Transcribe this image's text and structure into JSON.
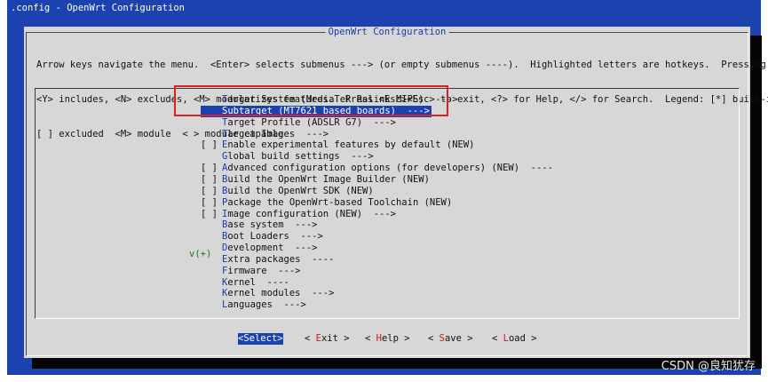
{
  "window": {
    "title": ".config - OpenWrt Configuration"
  },
  "dialog": {
    "title": "OpenWrt Configuration",
    "help_lines": [
      "Arrow keys navigate the menu.  <Enter> selects submenus ---> (or empty submenus ----).  Highlighted letters are hotkeys.  Pressing",
      "<Y> includes, <N> excludes, <M> modularizes features.  Press <Esc><Esc> to exit, <?> for Help, </> for Search.  Legend: [*] built-in",
      "[ ] excluded  <M> module  < > module capable"
    ]
  },
  "menu": {
    "items": [
      {
        "prefix": "",
        "hotkey": "T",
        "rest": "arget System (MediaTek Ralink MIPS)  --->",
        "selected": false
      },
      {
        "prefix": "",
        "hotkey": "S",
        "rest": "ubtarget (MT7621 based boards)  --->",
        "selected": true
      },
      {
        "prefix": "",
        "hotkey": "T",
        "rest": "arget Profile (ADSLR G7)  --->",
        "selected": false
      },
      {
        "prefix": "",
        "hotkey": "T",
        "rest": "arget Images  --->",
        "selected": false
      },
      {
        "prefix": "[ ]",
        "hotkey": "E",
        "rest": "nable experimental features by default (NEW)",
        "selected": false
      },
      {
        "prefix": "",
        "hotkey": "G",
        "rest": "lobal build settings  --->",
        "selected": false
      },
      {
        "prefix": "[ ]",
        "hotkey": "A",
        "rest": "dvanced configuration options (for developers) (NEW)  ----",
        "selected": false
      },
      {
        "prefix": "[ ]",
        "hotkey": "B",
        "rest": "uild the OpenWrt Image Builder (NEW)",
        "selected": false
      },
      {
        "prefix": "[ ]",
        "hotkey": "B",
        "rest": "uild the OpenWrt SDK (NEW)",
        "selected": false
      },
      {
        "prefix": "[ ]",
        "hotkey": "P",
        "rest": "ackage the OpenWrt-based Toolchain (NEW)",
        "selected": false
      },
      {
        "prefix": "[ ]",
        "hotkey": "I",
        "rest": "mage configuration (NEW)  --->",
        "selected": false
      },
      {
        "prefix": "",
        "hotkey": "B",
        "rest": "ase system  --->",
        "selected": false
      },
      {
        "prefix": "",
        "hotkey": "B",
        "rest": "oot Loaders  --->",
        "selected": false
      },
      {
        "prefix": "",
        "hotkey": "D",
        "rest": "evelopment  --->",
        "selected": false
      },
      {
        "prefix": "",
        "hotkey": "E",
        "rest": "xtra packages  ----",
        "selected": false
      },
      {
        "prefix": "",
        "hotkey": "F",
        "rest": "irmware  --->",
        "selected": false
      },
      {
        "prefix": "",
        "hotkey": "K",
        "rest": "ernel  ----",
        "selected": false
      },
      {
        "prefix": "",
        "hotkey": "K",
        "rest": "ernel modules  --->",
        "selected": false
      },
      {
        "prefix": "",
        "hotkey": "L",
        "rest": "anguages  --->",
        "selected": false
      }
    ],
    "more_indicator": "v(+)"
  },
  "buttons": [
    {
      "pre": "<",
      "hotkey": "S",
      "rest": "elect>",
      "active": true
    },
    {
      "pre": "< ",
      "hotkey": "E",
      "rest": "xit >",
      "active": false
    },
    {
      "pre": "< ",
      "hotkey": "H",
      "rest": "elp >",
      "active": false
    },
    {
      "pre": "< ",
      "hotkey": "S",
      "rest": "ave >",
      "active": false
    },
    {
      "pre": "< ",
      "hotkey": "L",
      "rest": "oad >",
      "active": false
    }
  ],
  "watermark": "CSDN @良知犹存",
  "colors": {
    "terminal_bg": "#1c42b0",
    "dialog_bg": "#d7d7d7",
    "hotkey": "#1a3ab0",
    "annotation": "#e02020"
  }
}
